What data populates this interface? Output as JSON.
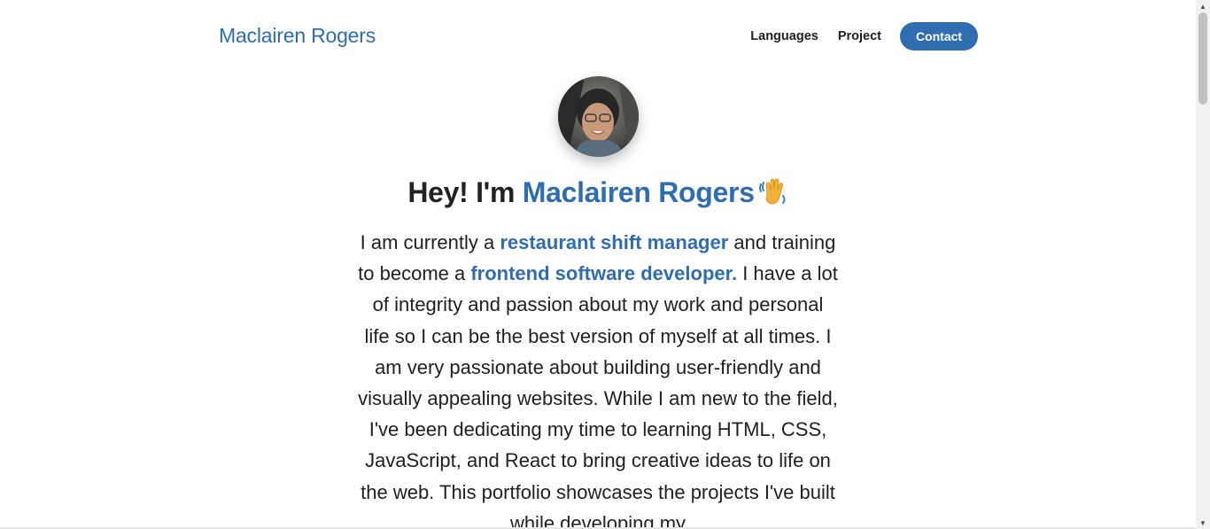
{
  "header": {
    "brand": "Maclairen Rogers",
    "nav": [
      {
        "label": "Languages"
      },
      {
        "label": "Project"
      }
    ],
    "contact_label": "Contact"
  },
  "hero": {
    "greeting": "Hey! I'm ",
    "name": "Maclairen Rogers",
    "wave_icon": "waving-hand-icon",
    "bio": {
      "part1": "I am currently a ",
      "highlight1": "restaurant shift manager",
      "part2": " and training to become a ",
      "highlight2": "frontend software developer.",
      "part3": " I have a lot of integrity and passion about my work and personal life so I can be the best version of myself at all times. I am very passionate about building user-friendly and visually appealing websites. While I am new to the field, I've been dedicating my time to learning HTML, CSS, JavaScript, and React to bring creative ideas to life on the web. This portfolio showcases the projects I've built while developing my"
    }
  },
  "colors": {
    "accent": "#2f6db0",
    "text": "#1f1f1f"
  }
}
